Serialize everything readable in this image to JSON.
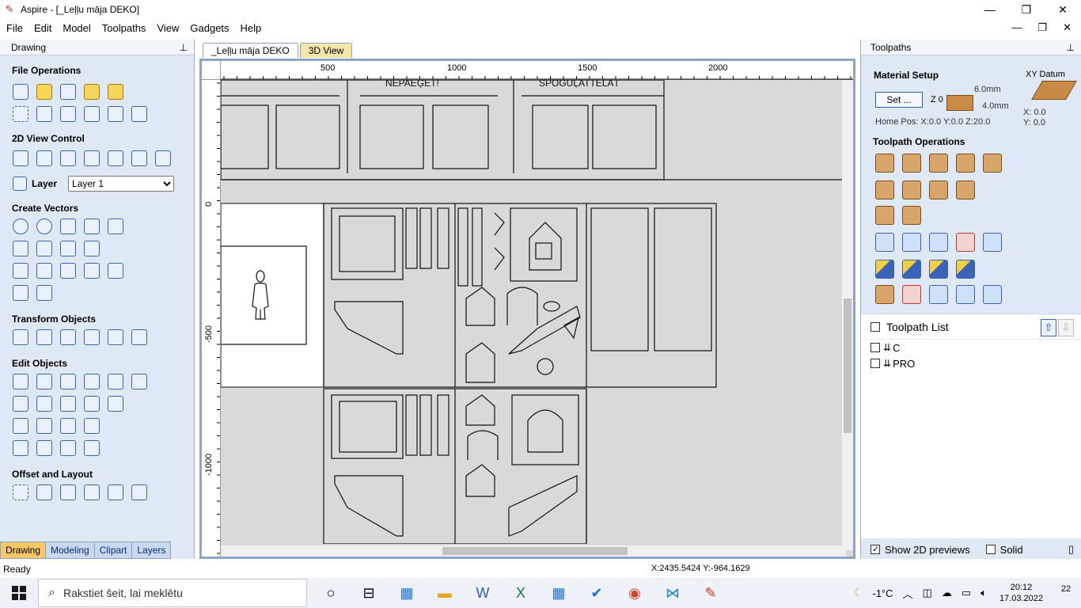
{
  "window": {
    "title": "Aspire - [_Leļļu māja DEKO]",
    "minimize": "—",
    "maximize": "❐",
    "close": "✕"
  },
  "menu": [
    "File",
    "Edit",
    "Model",
    "Toolpaths",
    "View",
    "Gadgets",
    "Help"
  ],
  "left_panel": {
    "header": "Drawing",
    "pin": "📌",
    "sections": {
      "file_operations": "File Operations",
      "view_control": "2D View Control",
      "create_vectors": "Create Vectors",
      "transform_objects": "Transform Objects",
      "edit_objects": "Edit Objects",
      "offset_layout": "Offset and Layout"
    },
    "layer_label": "Layer",
    "layer_value": "Layer 1",
    "tabs": [
      "Drawing",
      "Modeling",
      "Clipart",
      "Layers"
    ]
  },
  "document": {
    "tabs": [
      "_Leļļu māja DEKO",
      "3D View"
    ],
    "ruler_h": [
      "500",
      "1000",
      "1500",
      "2000"
    ],
    "ruler_v": [
      "0",
      "-500",
      "-1000"
    ],
    "labels": [
      "NEPAEĢĒT!",
      "SPOGUĻATTĒLĀT"
    ]
  },
  "right_panel": {
    "header": "Toolpaths",
    "material_setup": "Material Setup",
    "set_button": "Set ...",
    "z0": "Z 0",
    "thickness1": "6.0mm",
    "thickness2": "4.0mm",
    "home_pos": "Home Pos:  X:0.0 Y:0.0 Z:20.0",
    "xy_datum": "XY Datum",
    "xy_x": "X: 0.0",
    "xy_y": "Y: 0.0",
    "toolpath_operations": "Toolpath Operations",
    "toolpath_list": "Toolpath List",
    "toolpaths": [
      "C",
      "PRO"
    ],
    "show_previews": "Show 2D previews",
    "solid": "Solid"
  },
  "status": {
    "ready": "Ready",
    "coords": "X:2435.5424 Y:-964.1629"
  },
  "taskbar": {
    "search_placeholder": "Rakstiet šeit, lai meklētu",
    "weather": "-1°C",
    "time": "20:12",
    "date": "17.03.2022",
    "notifications": "22"
  },
  "colors": {
    "panel_bg": "#dfe8f5",
    "active_tab": "#f7c865",
    "canvas_bg": "#d9d9d9"
  }
}
